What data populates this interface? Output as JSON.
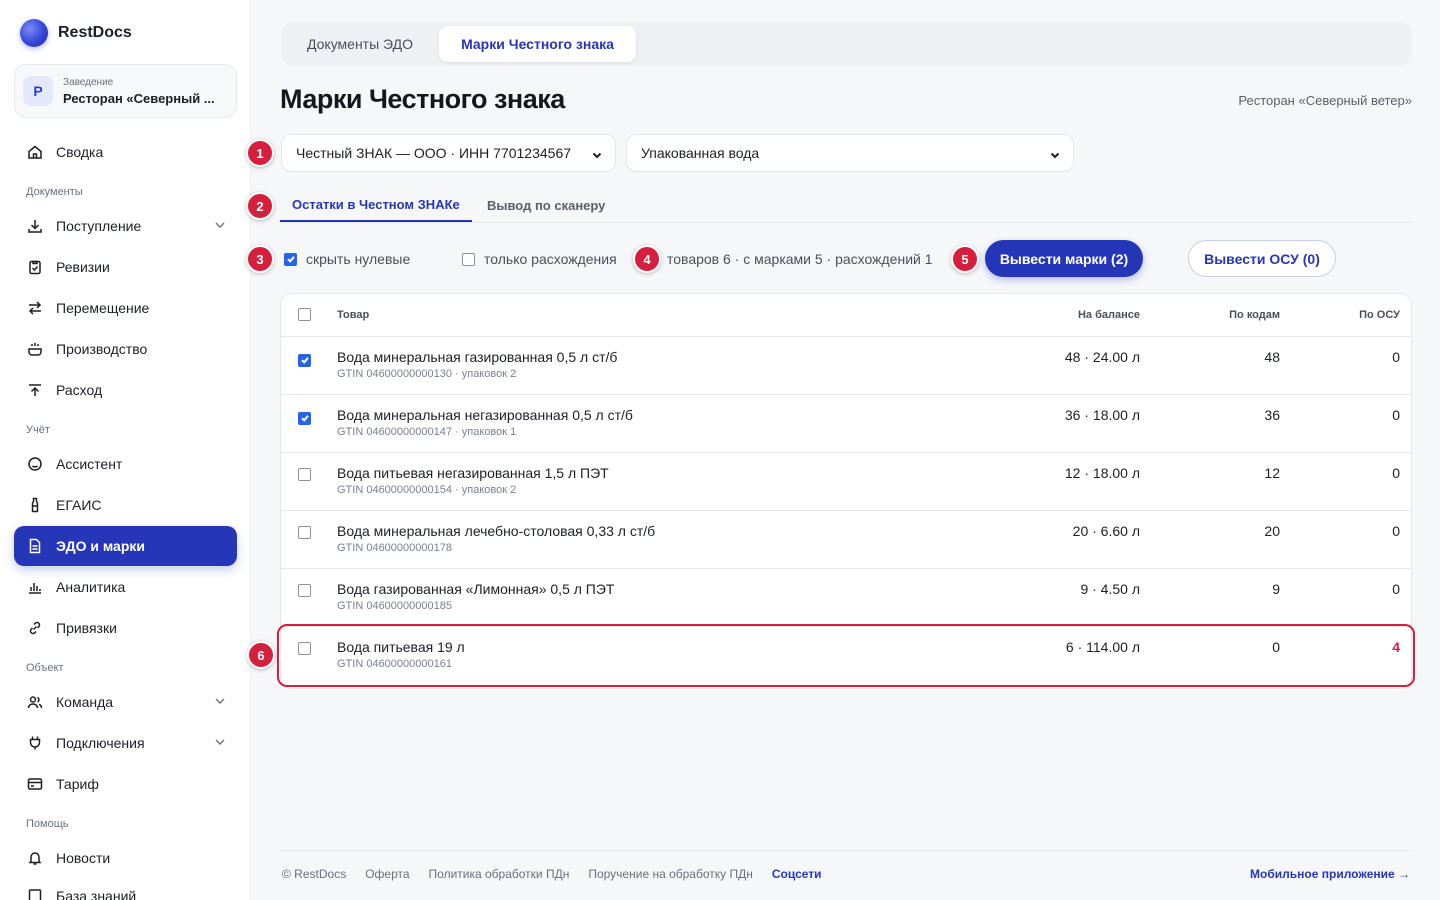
{
  "brand": {
    "name": "RestDocs"
  },
  "venue": {
    "avatar": "Р",
    "caption": "Заведение",
    "name": "Ресторан «Северный ..."
  },
  "sidebar": {
    "items": [
      {
        "label": "Сводка",
        "icon": "home-icon"
      },
      {
        "label": "Поступление",
        "icon": "download-icon"
      },
      {
        "label": "Ревизии",
        "icon": "clipboard-icon"
      },
      {
        "label": "Перемещение",
        "icon": "transfer-icon"
      },
      {
        "label": "Производство",
        "icon": "pot-icon"
      },
      {
        "label": "Расход",
        "icon": "upload-icon"
      },
      {
        "label": "Ассистент",
        "icon": "assistant-icon"
      },
      {
        "label": "ЕГАИС",
        "icon": "bottle-icon"
      },
      {
        "label": "ЭДО и марки",
        "icon": "document-icon"
      },
      {
        "label": "Аналитика",
        "icon": "chart-icon"
      },
      {
        "label": "Привязки",
        "icon": "link-icon"
      },
      {
        "label": "Команда",
        "icon": "users-icon"
      },
      {
        "label": "Подключения",
        "icon": "plug-icon"
      },
      {
        "label": "Тариф",
        "icon": "card-icon"
      },
      {
        "label": "Новости",
        "icon": "bell-icon"
      },
      {
        "label": "База знаний",
        "icon": "book-icon"
      }
    ],
    "sections": [
      "Документы",
      "Учёт",
      "Объект",
      "Помощь"
    ]
  },
  "top_tabs": [
    "Документы ЭДО",
    "Марки Честного знака"
  ],
  "page": {
    "title": "Марки Честного знака",
    "venue": "Ресторан «Северный ветер»"
  },
  "filters": {
    "org_select": "Честный ЗНАК — ООО · ИНН 7701234567",
    "category_select": "Упакованная вода"
  },
  "sub_tabs": [
    "Остатки в Честном ЗНАКе",
    "Вывод по сканеру"
  ],
  "options": {
    "hide_zero_label": "скрыть нулевые",
    "hide_zero_checked": true,
    "only_diff_label": "только расхождения",
    "only_diff_checked": false
  },
  "stats": "товаров 6 · с марками 5 · расхождений 1",
  "actions": {
    "primary": "Вывести марки (2)",
    "secondary": "Вывести ОСУ (0)"
  },
  "badges": [
    "1",
    "2",
    "3",
    "4",
    "5",
    "6"
  ],
  "table": {
    "headers": {
      "product": "Товар",
      "balance": "На балансе",
      "codes": "По кодам",
      "osu": "По ОСУ"
    },
    "rows": [
      {
        "checked": true,
        "name": "Вода минеральная газированная 0,5 л ст/б",
        "gtin": "GTIN 04600000000130 · упаковок 2",
        "balance": "48 · 24.00 л",
        "codes": "48",
        "osu": "0"
      },
      {
        "checked": true,
        "name": "Вода минеральная негазированная 0,5 л ст/б",
        "gtin": "GTIN 04600000000147 · упаковок 1",
        "balance": "36 · 18.00 л",
        "codes": "36",
        "osu": "0"
      },
      {
        "checked": false,
        "name": "Вода питьевая негазированная 1,5 л ПЭТ",
        "gtin": "GTIN 04600000000154 · упаковок 2",
        "balance": "12 · 18.00 л",
        "codes": "12",
        "osu": "0"
      },
      {
        "checked": false,
        "name": "Вода минеральная лечебно-столовая 0,33 л ст/б",
        "gtin": "GTIN 04600000000178",
        "balance": "20 · 6.60 л",
        "codes": "20",
        "osu": "0"
      },
      {
        "checked": false,
        "name": "Вода газированная «Лимонная» 0,5 л ПЭТ",
        "gtin": "GTIN 04600000000185",
        "balance": "9 · 4.50 л",
        "codes": "9",
        "osu": "0"
      },
      {
        "checked": false,
        "name": "Вода питьевая 19 л",
        "gtin": "GTIN 04600000000161",
        "balance": "6 · 114.00 л",
        "codes": "0",
        "osu": "4",
        "alert": true
      }
    ]
  },
  "footer": {
    "links": [
      "© RestDocs",
      "Оферта",
      "Политика обработки ПДн",
      "Поручение на обработку ПДн",
      "Соцсети"
    ],
    "mobile": "Мобильное приложение →"
  },
  "colors": {
    "accent": "#2636b8",
    "alert": "#d61f3d",
    "checkbox": "#2563eb"
  }
}
